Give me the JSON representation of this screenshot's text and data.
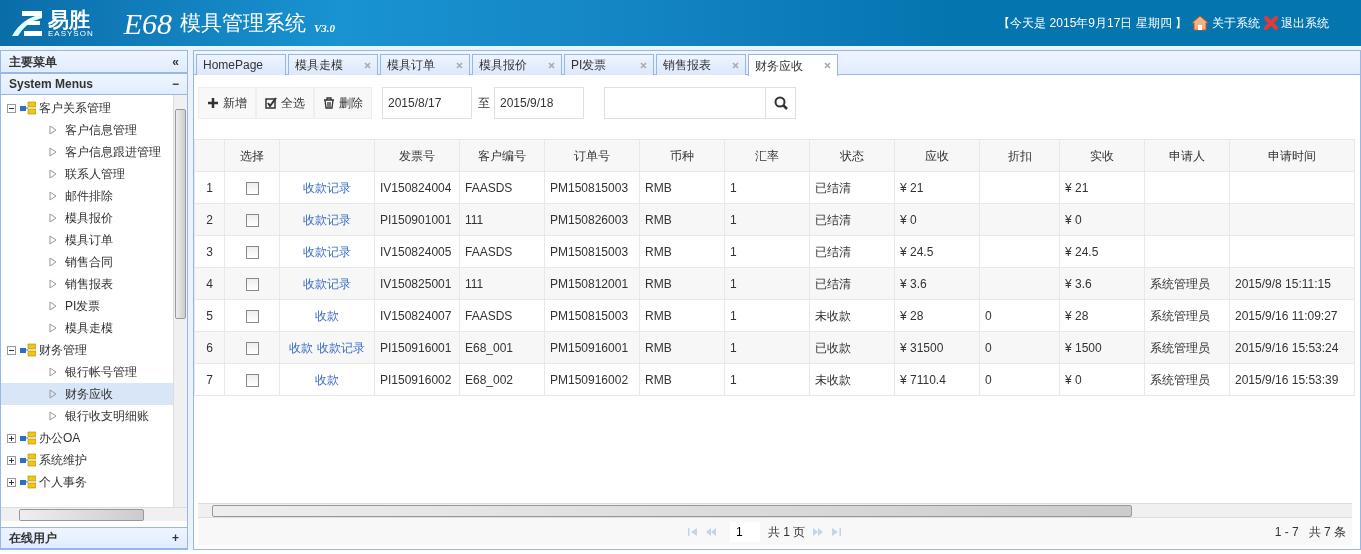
{
  "header": {
    "brand": "易胜",
    "brand_sub": "EASYSON",
    "product": "E68",
    "title": "模具管理系统",
    "version": "V3.0",
    "date_text": "【今天是 2015年9月17日 星期四 】",
    "links": [
      "关于系统",
      "退出系统"
    ]
  },
  "sidebar": {
    "title": "主要菜单",
    "collapse_glyph": "«",
    "section": "System Menus",
    "section_glyph": "−",
    "tree": [
      {
        "label": "客户关系管理",
        "expanded": true,
        "children": [
          {
            "label": "客户信息管理",
            "selected": false
          },
          {
            "label": "客户信息跟进管理",
            "selected": false
          },
          {
            "label": "联系人管理",
            "selected": false
          },
          {
            "label": "邮件排除",
            "selected": false
          },
          {
            "label": "模具报价",
            "selected": false
          },
          {
            "label": "模具订单",
            "selected": false
          },
          {
            "label": "销售合同",
            "selected": false
          },
          {
            "label": "销售报表",
            "selected": false
          },
          {
            "label": "PI发票",
            "selected": false
          },
          {
            "label": "模具走模",
            "selected": false
          }
        ]
      },
      {
        "label": "财务管理",
        "expanded": true,
        "children": [
          {
            "label": "银行帐号管理",
            "selected": false
          },
          {
            "label": "财务应收",
            "selected": true
          },
          {
            "label": "银行收支明细账",
            "selected": false
          }
        ]
      },
      {
        "label": "办公OA",
        "expanded": false
      },
      {
        "label": "系统维护",
        "expanded": false
      },
      {
        "label": "个人事务",
        "expanded": false
      }
    ],
    "footer": "在线用户",
    "footer_glyph": "+"
  },
  "tabs": [
    {
      "label": "HomePage",
      "selected": false,
      "closable": false
    },
    {
      "label": "模具走模",
      "selected": false,
      "closable": true
    },
    {
      "label": "模具订单",
      "selected": false,
      "closable": true
    },
    {
      "label": "模具报价",
      "selected": false,
      "closable": true
    },
    {
      "label": "PI发票",
      "selected": false,
      "closable": true
    },
    {
      "label": "销售报表",
      "selected": false,
      "closable": true
    },
    {
      "label": "财务应收",
      "selected": true,
      "closable": true
    }
  ],
  "toolbar": {
    "buttons": [
      {
        "label": "新增",
        "kind": "add"
      },
      {
        "label": "全选",
        "kind": "select"
      },
      {
        "label": "删除",
        "kind": "delete"
      }
    ],
    "date_from": "2015/8/17",
    "date_sep": "至",
    "date_to": "2015/9/18"
  },
  "table": {
    "columns": [
      "",
      "选择",
      "",
      "发票号",
      "客户编号",
      "订单号",
      "币种",
      "汇率",
      "状态",
      "应收",
      "折扣",
      "实收",
      "申请人",
      "申请时间"
    ],
    "rows": [
      {
        "checked": false,
        "actions": [
          "收款记录"
        ],
        "cells": [
          "1",
          "",
          "",
          "IV150824004",
          "FAASDS",
          "PM150815003",
          "RMB",
          "1",
          "已结清",
          "¥ 21",
          "",
          "¥ 21",
          "",
          ""
        ]
      },
      {
        "checked": false,
        "actions": [
          "收款记录"
        ],
        "cells": [
          "2",
          "",
          "",
          "PI150901001",
          "111",
          "PM150826003",
          "RMB",
          "1",
          "已结清",
          "¥ 0",
          "",
          "¥ 0",
          "",
          ""
        ]
      },
      {
        "checked": false,
        "actions": [
          "收款记录"
        ],
        "cells": [
          "3",
          "",
          "",
          "IV150824005",
          "FAASDS",
          "PM150815003",
          "RMB",
          "1",
          "已结清",
          "¥ 24.5",
          "",
          "¥ 24.5",
          "",
          ""
        ]
      },
      {
        "checked": false,
        "actions": [
          "收款记录"
        ],
        "cells": [
          "4",
          "",
          "",
          "IV150825001",
          "111",
          "PM150812001",
          "RMB",
          "1",
          "已结清",
          "¥ 3.6",
          "",
          "¥ 3.6",
          "系统管理员",
          "2015/9/8 15:11:15"
        ]
      },
      {
        "checked": false,
        "actions": [
          "收款"
        ],
        "cells": [
          "5",
          "",
          "",
          "IV150824007",
          "FAASDS",
          "PM150815003",
          "RMB",
          "1",
          "未收款",
          "¥ 28",
          "0",
          "¥ 28",
          "系统管理员",
          "2015/9/16 11:09:27"
        ]
      },
      {
        "checked": false,
        "actions": [
          "收款",
          "收款记录"
        ],
        "cells": [
          "6",
          "",
          "",
          "PI150916001",
          "E68_001",
          "PM150916001",
          "RMB",
          "1",
          "已收款",
          "¥ 31500",
          "0",
          "¥ 1500",
          "系统管理员",
          "2015/9/16 15:53:24"
        ]
      },
      {
        "checked": false,
        "actions": [
          "收款"
        ],
        "cells": [
          "7",
          "",
          "",
          "PI150916002",
          "E68_002",
          "PM150916002",
          "RMB",
          "1",
          "未收款",
          "¥ 7110.4",
          "0",
          "¥ 0",
          "系统管理员",
          "2015/9/16 15:53:39"
        ]
      }
    ]
  },
  "pager": {
    "page": "1",
    "pages_text": "共 1 页",
    "summary": "1 - 7   共 7 条"
  }
}
